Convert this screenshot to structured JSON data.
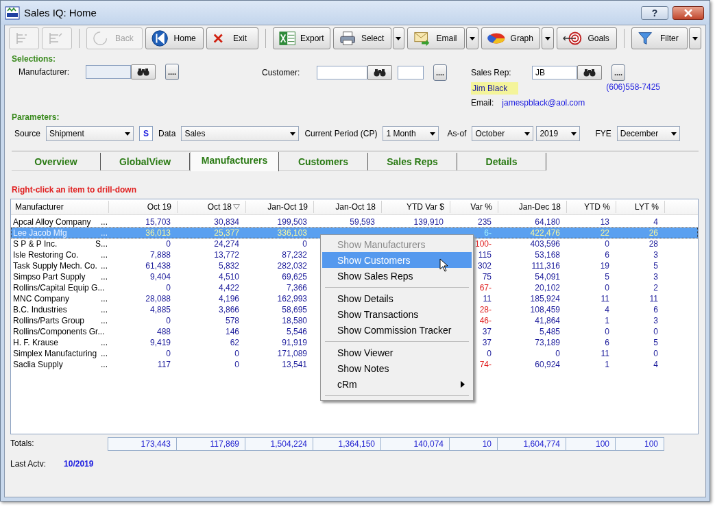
{
  "window": {
    "title": "Sales IQ: Home",
    "help": "?"
  },
  "toolbar": [
    {
      "kind": "button",
      "disabled": true
    },
    {
      "kind": "button",
      "disabled": true
    },
    {
      "kind": "separator"
    },
    {
      "kind": "button",
      "label": "Back",
      "disabled": true
    },
    {
      "kind": "button",
      "label": "Home",
      "disabled": false
    },
    {
      "kind": "button",
      "label": "Exit",
      "disabled": false
    },
    {
      "kind": "separator"
    },
    {
      "kind": "button",
      "label": "Export",
      "disabled": false
    },
    {
      "kind": "button",
      "label": "Select",
      "disabled": false,
      "has_menu": true
    },
    {
      "kind": "button",
      "label": "Email",
      "disabled": false,
      "has_menu": true
    },
    {
      "kind": "button",
      "label": "Graph",
      "disabled": false,
      "has_menu": true
    },
    {
      "kind": "button",
      "label": "Goals",
      "disabled": false
    },
    {
      "kind": "separator"
    },
    {
      "kind": "button",
      "label": "Filter",
      "disabled": false,
      "has_menu": true
    }
  ],
  "selections": {
    "heading": "Selections:",
    "manufacturer_label": "Manufacturer:",
    "more": "....",
    "customer_label": "Customer:",
    "sales_rep_label": "Sales Rep:",
    "sales_rep_value": "JB",
    "rep_name": "Jim Black",
    "rep_phone": "(606)558-7425",
    "email_label": "Email:",
    "rep_email": "jamespblack@aol.com"
  },
  "parameters": {
    "heading": "Parameters:",
    "source_label": "Source",
    "source": "Shipment",
    "source_flag": "S",
    "data_label": "Data",
    "data": "Sales",
    "period_label": "Current Period (CP)",
    "period": "1 Month",
    "as_of_label": "As-of",
    "as_of_month": "October",
    "as_of_year": "2019",
    "fye_label": "FYE",
    "fye": "December"
  },
  "tabs": [
    {
      "label": "Overview",
      "selected": false
    },
    {
      "label": "GlobalView",
      "selected": false
    },
    {
      "label": "Manufacturers",
      "selected": true
    },
    {
      "label": "Customers",
      "selected": false
    },
    {
      "label": "Sales Reps",
      "selected": false
    },
    {
      "label": "Details",
      "selected": false
    }
  ],
  "hint": "Right-click an item to drill-down",
  "table": {
    "columns": [
      {
        "label": "Manufacturer",
        "sorted": false
      },
      {
        "label": "Oct 19",
        "sorted": false
      },
      {
        "label": "Oct 18",
        "sorted": true
      },
      {
        "label": "Jan-Oct 19",
        "sorted": false
      },
      {
        "label": "Jan-Oct 18",
        "sorted": false
      },
      {
        "label": "YTD Var $",
        "sorted": false
      },
      {
        "label": "Var %",
        "sorted": false
      },
      {
        "label": "Jan-Dec 18",
        "sorted": false
      },
      {
        "label": "YTD %",
        "sorted": false
      },
      {
        "label": "LYT %",
        "sorted": false
      }
    ],
    "rows": [
      {
        "suffix": "...",
        "cells": [
          "Apcal Alloy Company",
          "15,703",
          "30,834",
          "199,503",
          "59,593",
          "139,910",
          "235",
          "64,180",
          "13",
          "4"
        ],
        "selected": false,
        "var_negative": false
      },
      {
        "suffix": "...",
        "cells": [
          "Lee Jacob Mfg",
          "36,013",
          "25,377",
          "336,103",
          null,
          null,
          "6-",
          "422,476",
          "22",
          "26"
        ],
        "selected": true,
        "var_negative": true
      },
      {
        "suffix": "S...",
        "cells": [
          "S P & P Inc.",
          "0",
          "24,274",
          "0",
          null,
          null,
          "100-",
          "403,596",
          "0",
          "28"
        ],
        "selected": false,
        "var_negative": true
      },
      {
        "suffix": "...",
        "cells": [
          "Isle Restoring Co.",
          "7,888",
          "13,772",
          "87,232",
          null,
          null,
          "115",
          "53,168",
          "6",
          "3"
        ],
        "selected": false,
        "var_negative": false
      },
      {
        "suffix": "...",
        "cells": [
          "Task Supply Mech. Co.",
          "61,438",
          "5,832",
          "282,032",
          null,
          null,
          "302",
          "111,316",
          "19",
          "5"
        ],
        "selected": false,
        "var_negative": false
      },
      {
        "suffix": "...",
        "cells": [
          "Simpso Part Supply",
          "9,404",
          "4,510",
          "69,625",
          null,
          null,
          "75",
          "54,091",
          "5",
          "3"
        ],
        "selected": false,
        "var_negative": false
      },
      {
        "cells": [
          "Rollins/Capital Equip G...",
          "0",
          "4,422",
          "7,366",
          null,
          null,
          "67-",
          "20,102",
          "0",
          "2"
        ],
        "selected": false,
        "var_negative": true
      },
      {
        "suffix": "...",
        "cells": [
          "MNC Company",
          "28,088",
          "4,196",
          "162,993",
          null,
          null,
          "11",
          "185,924",
          "11",
          "11"
        ],
        "selected": false,
        "var_negative": false
      },
      {
        "suffix": "...",
        "cells": [
          "B.C. Industries",
          "4,885",
          "3,866",
          "58,695",
          null,
          null,
          "28-",
          "108,459",
          "4",
          "6"
        ],
        "selected": false,
        "var_negative": true
      },
      {
        "suffix": "...",
        "cells": [
          "Rollins/Parts Group",
          "0",
          "578",
          "18,580",
          null,
          null,
          "46-",
          "41,864",
          "1",
          "3"
        ],
        "selected": false,
        "var_negative": true
      },
      {
        "cells": [
          "Rollins/Components Gr...",
          "488",
          "146",
          "5,546",
          null,
          null,
          "37",
          "5,485",
          "0",
          "0"
        ],
        "selected": false,
        "var_negative": false
      },
      {
        "suffix": "...",
        "cells": [
          "H. F. Krause",
          "9,419",
          "62",
          "91,919",
          null,
          null,
          "37",
          "73,189",
          "6",
          "5"
        ],
        "selected": false,
        "var_negative": false
      },
      {
        "suffix": "...",
        "cells": [
          "Simplex Manufacturing",
          "0",
          "0",
          "171,089",
          null,
          null,
          "0",
          "0",
          "11",
          "0"
        ],
        "selected": false,
        "var_negative": false
      },
      {
        "suffix": "...",
        "cells": [
          "Saclia Supply",
          "117",
          "0",
          "13,541",
          null,
          null,
          "74-",
          "60,924",
          "1",
          "4"
        ],
        "selected": false,
        "var_negative": true
      }
    ],
    "totals_label": "Totals:",
    "totals": [
      "173,443",
      "117,869",
      "1,504,224",
      "1,364,150",
      "140,074",
      "10",
      "1,604,774",
      "100",
      "100"
    ]
  },
  "last_activity": {
    "label": "Last Actv:",
    "value": "10/2019"
  },
  "context_menu": [
    {
      "kind": "item",
      "label": "Show Manufacturers",
      "disabled": true,
      "selected": false
    },
    {
      "kind": "item",
      "label": "Show Customers",
      "disabled": false,
      "selected": true
    },
    {
      "kind": "item",
      "label": "Show Sales Reps",
      "disabled": false,
      "selected": false
    },
    {
      "kind": "separator"
    },
    {
      "kind": "item",
      "label": "Show Details",
      "disabled": false,
      "selected": false
    },
    {
      "kind": "item",
      "label": "Show Transactions",
      "disabled": false,
      "selected": false
    },
    {
      "kind": "item",
      "label": "Show Commission Tracker",
      "disabled": false,
      "selected": false
    },
    {
      "kind": "separator"
    },
    {
      "kind": "item",
      "label": "Show Viewer",
      "disabled": false,
      "selected": false
    },
    {
      "kind": "item",
      "label": "Show Notes",
      "disabled": false,
      "selected": false
    },
    {
      "kind": "item",
      "label": "cRm",
      "disabled": false,
      "selected": false,
      "submenu": true
    },
    {
      "kind": "separator"
    }
  ]
}
